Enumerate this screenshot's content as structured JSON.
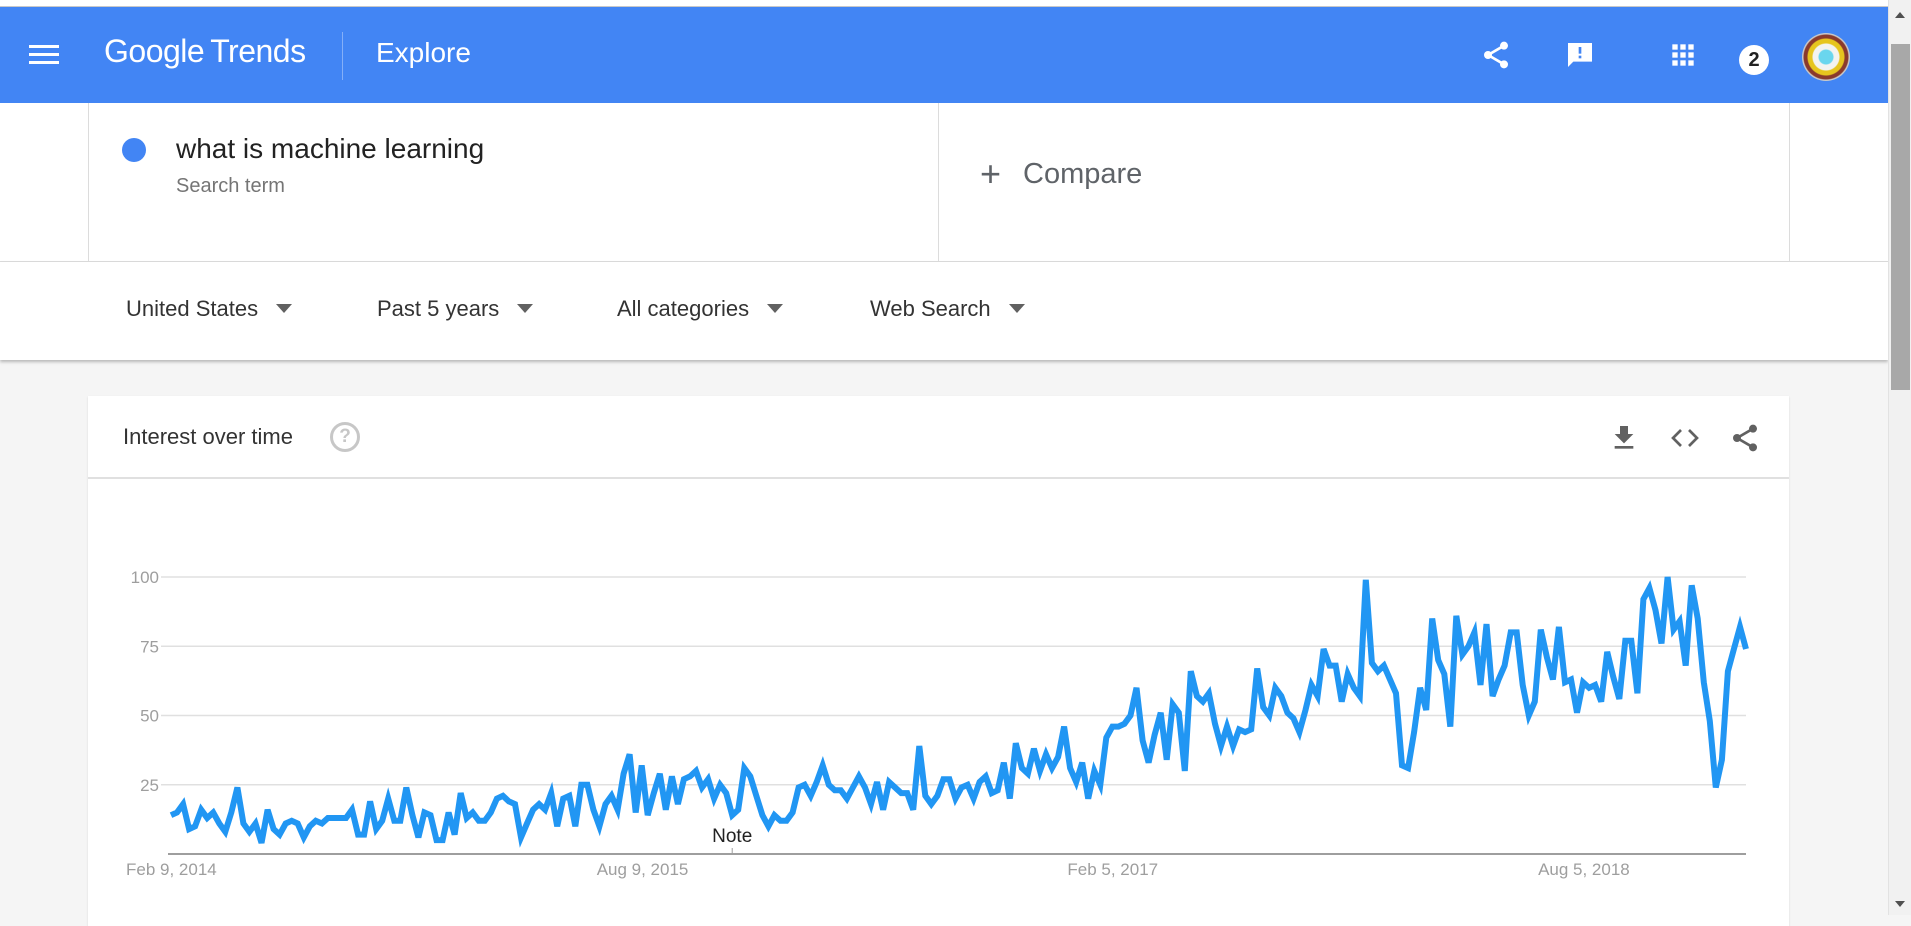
{
  "header": {
    "app_name_google": "Google",
    "app_name_trends": "Trends",
    "section": "Explore",
    "notification_count": "2",
    "brand_color": "#4285f4"
  },
  "search": {
    "term": "what is machine learning",
    "term_sublabel": "Search term",
    "term_color": "#4285f4",
    "compare_label": "Compare"
  },
  "filters": [
    {
      "label": "United States"
    },
    {
      "label": "Past 5 years"
    },
    {
      "label": "All categories"
    },
    {
      "label": "Web Search"
    }
  ],
  "card": {
    "title": "Interest over time",
    "help_glyph": "?"
  },
  "icons": {
    "menu": "hamburger-menu-icon",
    "share": "share-icon",
    "feedback": "feedback-icon",
    "apps": "apps-grid-icon",
    "avatar": "account-avatar",
    "download": "download-icon",
    "embed": "embed-code-icon",
    "card_share": "share-icon"
  },
  "chart_data": {
    "type": "line",
    "title": "Interest over time",
    "xlabel": "",
    "ylabel": "",
    "ylim": [
      0,
      100
    ],
    "yticks": [
      25,
      50,
      75,
      100
    ],
    "xtick_labels": [
      {
        "label": "Feb 9, 2014",
        "index": 0
      },
      {
        "label": "Aug 9, 2015",
        "index": 78
      },
      {
        "label": "Feb 5, 2017",
        "index": 156
      },
      {
        "label": "Aug 5, 2018",
        "index": 234
      }
    ],
    "annotations": [
      {
        "label": "Note",
        "index": 93
      }
    ],
    "grid": true,
    "legend": "none",
    "series": [
      {
        "name": "what is machine learning",
        "color": "#2196f3",
        "values": [
          14,
          15,
          18,
          9,
          10,
          16,
          13,
          15,
          11,
          8,
          15,
          24,
          11,
          8,
          11,
          4,
          16,
          9,
          7,
          11,
          12,
          11,
          6,
          10,
          12,
          11,
          13,
          13,
          13,
          13,
          16,
          7,
          7,
          19,
          9,
          12,
          20,
          12,
          12,
          24,
          14,
          6,
          15,
          14,
          5,
          5,
          15,
          7,
          22,
          13,
          15,
          12,
          12,
          15,
          20,
          21,
          19,
          18,
          6,
          11,
          16,
          18,
          16,
          22,
          10,
          20,
          21,
          10,
          25,
          25,
          16,
          10,
          18,
          21,
          16,
          29,
          36,
          15,
          32,
          14,
          22,
          29,
          16,
          28,
          18,
          27,
          28,
          30,
          24,
          27,
          20,
          25,
          22,
          14,
          16,
          31,
          28,
          21,
          14,
          10,
          14,
          12,
          12,
          15,
          24,
          25,
          21,
          26,
          32,
          25,
          23,
          23,
          20,
          24,
          28,
          24,
          18,
          26,
          16,
          26,
          24,
          22,
          22,
          16,
          39,
          21,
          18,
          21,
          27,
          27,
          20,
          24,
          25,
          20,
          26,
          28,
          22,
          23,
          33,
          20,
          40,
          31,
          29,
          38,
          30,
          36,
          31,
          35,
          46,
          31,
          26,
          33,
          20,
          30,
          25,
          42,
          46,
          46,
          47,
          50,
          60,
          41,
          33,
          43,
          51,
          34,
          54,
          51,
          30,
          66,
          57,
          55,
          58,
          47,
          39,
          46,
          39,
          45,
          44,
          45,
          67,
          53,
          50,
          60,
          57,
          51,
          49,
          44,
          52,
          61,
          57,
          74,
          68,
          68,
          55,
          65,
          60,
          57,
          99,
          69,
          66,
          68,
          63,
          58,
          32,
          31,
          44,
          60,
          52,
          85,
          70,
          65,
          46,
          86,
          72,
          75,
          80,
          61,
          83,
          57,
          63,
          68,
          80,
          80,
          61,
          50,
          55,
          81,
          71,
          63,
          82,
          62,
          63,
          51,
          62,
          60,
          61,
          55,
          73,
          64,
          56,
          77,
          77,
          58,
          92,
          96,
          88,
          76,
          100,
          81,
          84,
          68,
          97,
          85,
          62,
          48,
          24,
          34,
          66,
          74,
          82,
          74
        ]
      }
    ]
  }
}
